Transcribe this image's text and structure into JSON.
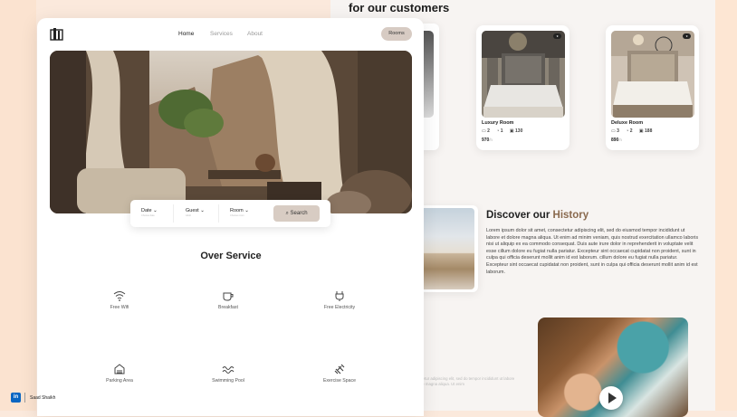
{
  "front": {
    "nav": [
      "Home",
      "Services",
      "About"
    ],
    "rooms_button": "Rooms",
    "search": {
      "fields": [
        {
          "label": "Date",
          "sub": "Choose date"
        },
        {
          "label": "Guest",
          "sub": "Adult"
        },
        {
          "label": "Room",
          "sub": "Choose room"
        }
      ],
      "button": "Search"
    },
    "section_title": "Over Service",
    "services": [
      {
        "icon": "wifi-icon",
        "label": "Free Wifi"
      },
      {
        "icon": "cup-icon",
        "label": "Breakfast"
      },
      {
        "icon": "plug-icon",
        "label": "Free Electricity"
      },
      {
        "icon": "parking-icon",
        "label": "Parking Area"
      },
      {
        "icon": "wave-icon",
        "label": "Swimming Pool"
      },
      {
        "icon": "dumbbell-icon",
        "label": "Exercise Space"
      }
    ]
  },
  "back": {
    "title": "for our customers",
    "rooms": [
      {
        "name": "Luxury Room",
        "beds": "2",
        "baths": "1",
        "area": "130",
        "price": "970",
        "price_suffix": "/n"
      },
      {
        "name": "Deluxe Room",
        "beds": "3",
        "baths": "2",
        "area": "188",
        "price": "890",
        "price_suffix": "/n"
      }
    ],
    "history": {
      "title_prefix": "Discover our",
      "title_highlight": "History",
      "text": "Lorem ipsum dolor sit amet, consectetur adipiscing elit, sed do eiusmod tempor incididunt ut labore et dolore magna aliqua. Ut enim ad minim veniam, quis nostrud exercitation ullamco laboris nisi ut aliquip ex ea commodo consequat. Duis aute irure dolor in reprehenderit in voluptate velit esse cillum dolore eu fugiat nulla pariatur. Excepteur sint occaecat cupidatat non proident, sunt in culpa qui officia deserunt mollit anim id est laborum. cillum dolore eu fugiat nulla pariatur. Excepteur sint occaecat cupidatat non proident, sunt in culpa qui officia deserunt mollit anim id est laborum."
    },
    "faint_text": "consectetur adipiscing elit, sed do tempor incididunt ut labore et dolore magna aliqua. Ut enim"
  },
  "credit": {
    "badge": "in",
    "name": "Saad Shaikh"
  }
}
